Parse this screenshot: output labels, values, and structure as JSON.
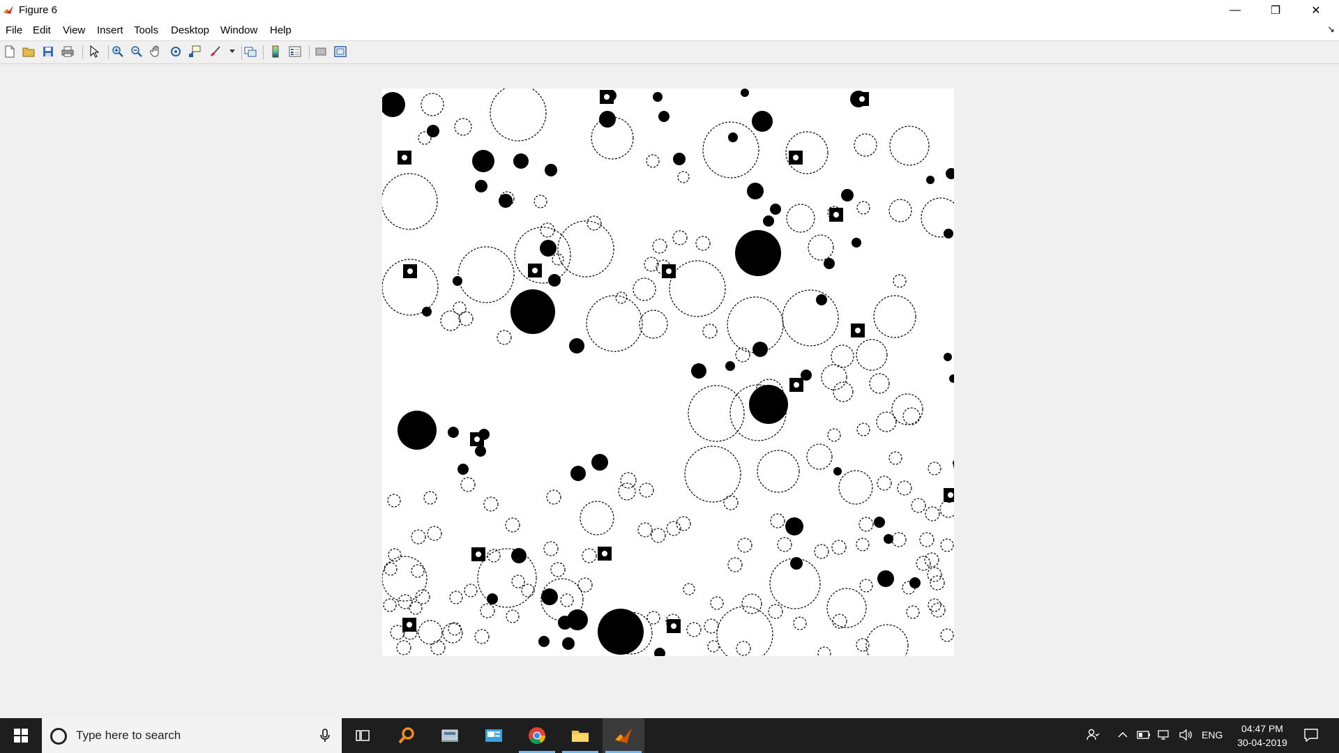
{
  "window": {
    "title": "Figure 6",
    "app_icon": "matlab-icon",
    "controls": {
      "minimize": "—",
      "maximize": "❐",
      "close": "✕"
    }
  },
  "menubar": {
    "items": [
      "File",
      "Edit",
      "View",
      "Insert",
      "Tools",
      "Desktop",
      "Window",
      "Help"
    ],
    "dock_arrow": "↘"
  },
  "toolbar": {
    "buttons": [
      "new-figure-icon",
      "open-file-icon",
      "save-icon",
      "print-icon",
      "edit-plot-arrow-icon",
      "zoom-in-icon",
      "zoom-out-icon",
      "pan-hand-icon",
      "rotate-3d-icon",
      "data-cursor-icon",
      "brush-icon",
      "link-plot-icon",
      "insert-colorbar-icon",
      "insert-legend-icon",
      "hide-plot-tools-icon",
      "show-plot-tools-icon"
    ]
  },
  "figure": {
    "image": "binary-image-circles",
    "colors": {
      "foreground": "#000000",
      "background": "#ffffff"
    }
  },
  "taskbar": {
    "search_placeholder": "Type here to search",
    "apps": [
      "task-view-icon",
      "search-app-icon",
      "scanner-icon",
      "outlook-icon",
      "chrome-icon",
      "file-explorer-icon",
      "matlab-icon"
    ],
    "active_app": "matlab-icon",
    "tray": {
      "language": "ENG",
      "time": "04:47 PM",
      "date": "30-04-2019"
    }
  }
}
